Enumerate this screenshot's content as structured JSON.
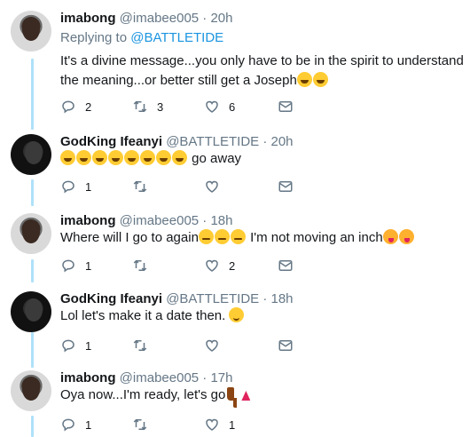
{
  "tweets": [
    {
      "display_name": "imabong",
      "handle": "@imabee005",
      "time": "20h",
      "replying_prefix": "Replying to ",
      "replying_handle": "@BATTLETIDE",
      "text": "It's a divine message...you only have to be in the spirit to understand the meaning...or better still get a Joseph",
      "emojis": [
        "laugh",
        "laugh"
      ],
      "reply_count": "2",
      "retweet_count": "3",
      "like_count": "6"
    },
    {
      "display_name": "GodKing Ifeanyi",
      "handle": "@BATTLETIDE",
      "time": "20h",
      "text": "go away",
      "emojis_before": [
        "laugh",
        "laugh",
        "laugh",
        "laugh",
        "laugh",
        "laugh",
        "laugh",
        "laugh"
      ],
      "reply_count": "1",
      "retweet_count": "",
      "like_count": ""
    },
    {
      "display_name": "imabong",
      "handle": "@imabee005",
      "time": "18h",
      "text_a": "Where will I go to again",
      "emojis_mid": [
        "relieved",
        "relieved",
        "relieved"
      ],
      "text_b": " I'm not moving an inch",
      "emojis": [
        "yum",
        "yum"
      ],
      "reply_count": "1",
      "retweet_count": "",
      "like_count": "2"
    },
    {
      "display_name": "GodKing Ifeanyi",
      "handle": "@BATTLETIDE",
      "time": "18h",
      "text": "Lol let's make it a date then. ",
      "emojis": [
        "wink"
      ],
      "reply_count": "1",
      "retweet_count": "",
      "like_count": ""
    },
    {
      "display_name": "imabong",
      "handle": "@imabee005",
      "time": "17h",
      "text": "Oya now...I'm ready, let's go",
      "emojis": [
        "boot",
        "dancer"
      ],
      "reply_count": "1",
      "retweet_count": "",
      "like_count": "1"
    }
  ],
  "separator": " · ",
  "colors": {
    "thread_line": "#aee1f9",
    "link": "#1b95e0",
    "muted": "#657786"
  },
  "icons": [
    "reply-icon",
    "retweet-icon",
    "like-icon",
    "direct-message-icon"
  ]
}
